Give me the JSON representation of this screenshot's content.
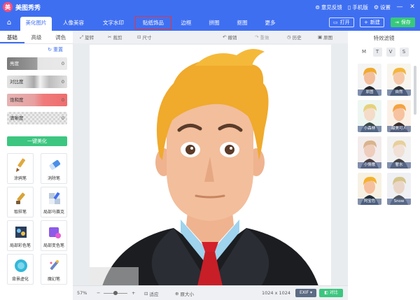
{
  "app": {
    "title": "美图秀秀",
    "logo_char": "美"
  },
  "titlebar": {
    "feedback": "意见反馈",
    "mobile": "手机版",
    "settings": "设置",
    "minimize": "—",
    "close": "✕"
  },
  "nav": {
    "home_icon": "⌂",
    "tabs": [
      "美化图片",
      "人像美容",
      "文字水印",
      "贴纸饰品",
      "边框",
      "拼图",
      "抠图",
      "更多"
    ],
    "open": "打开",
    "new": "新建",
    "save": "保存"
  },
  "left": {
    "subtabs": [
      "基础",
      "高级",
      "调色"
    ],
    "reset": "重置",
    "sliders": [
      {
        "label": "亮度",
        "value": "0"
      },
      {
        "label": "对比度",
        "value": "0"
      },
      {
        "label": "饱和度",
        "value": "0"
      },
      {
        "label": "清晰度",
        "value": "0"
      }
    ],
    "one_click": "一键美化",
    "tools": [
      "涂鸦笔",
      "消除笔",
      "取样笔",
      "局部马赛克",
      "局部彩色笔",
      "局部变色笔",
      "背景虚化",
      "魔幻笔"
    ]
  },
  "toolbar": {
    "rotate": "旋转",
    "crop": "裁剪",
    "size": "尺寸",
    "undo": "撤销",
    "redo": "重做",
    "history": "历史",
    "original": "原图"
  },
  "bottom": {
    "zoom": "57%",
    "fit": "适应",
    "actual": "原大小",
    "dimensions": "1024 x 1024",
    "exif": "EXIF",
    "compare": "对比"
  },
  "right": {
    "title": "特效滤镜",
    "filter_tabs": [
      "M",
      "T",
      "V",
      "S"
    ],
    "filters": [
      "原图",
      "自然",
      "小森林",
      "甜美可人",
      "小情歌",
      "奢水",
      "阿宝色",
      "Snow"
    ]
  },
  "colors": {
    "brand_blue": "#3f6ff1",
    "green": "#3cc680",
    "highlight_red": "#e8333a"
  }
}
